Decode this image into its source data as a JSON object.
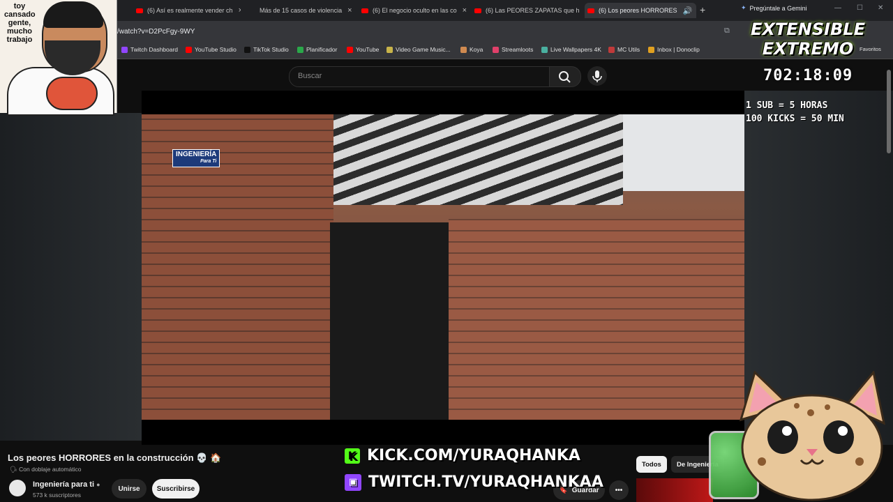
{
  "browser": {
    "tabs": [
      {
        "label": "(6) Así es realmente vender ch"
      },
      {
        "label": "Más de 15 casos de violencia"
      },
      {
        "label": "(6) El negocio oculto en las co"
      },
      {
        "label": "(6) Las PEORES ZAPATAS que h"
      },
      {
        "label": "(6) Los peores HORRORES"
      }
    ],
    "gemini": "Pregúntale a Gemini",
    "url": "/watch?v=D2PcFgy-9WY",
    "bookmarks": [
      {
        "label": "Twitch Dashboard",
        "color": "#9146ff"
      },
      {
        "label": "YouTube Studio",
        "color": "#ff0000"
      },
      {
        "label": "TikTok Studio",
        "color": "#111111"
      },
      {
        "label": "Planificador",
        "color": "#2aa84a"
      },
      {
        "label": "YouTube",
        "color": "#ff0000"
      },
      {
        "label": "Video Game Music...",
        "color": "#c8b44a"
      },
      {
        "label": "Koya",
        "color": "#d08a50"
      },
      {
        "label": "Streamloots",
        "color": "#e0406a"
      },
      {
        "label": "Live Wallpapers 4K",
        "color": "#4ab0a0"
      },
      {
        "label": "MC Utils",
        "color": "#c03a3a"
      },
      {
        "label": "Inbox | Donoclip",
        "color": "#e0a020"
      },
      {
        "label": "Favoritos",
        "color": "#888888"
      }
    ]
  },
  "youtube": {
    "search_placeholder": "Buscar",
    "video_logo": {
      "line1": "INGENIERÍA",
      "line2": "Para Ti"
    },
    "title": "Los peores HORRORES en la construcción 💀 🏠",
    "dub": "Con doblaje automático",
    "channel": "Ingeniería para ti",
    "subscribers": "573 k suscriptores",
    "join_label": "Unirse",
    "subscribe_label": "Suscribirse",
    "save_label": "Guardar",
    "more_label": "•••",
    "chips": [
      "Todos",
      "De Ingeniería"
    ]
  },
  "overlay": {
    "webcam_caption": "toy cansado gente, mucho trabajo",
    "event_logo": {
      "line1": "EXTENSIBLE",
      "line2": "EXTREMO"
    },
    "timer": "702:18:09",
    "rules": [
      "1 SUB = 5 HORAS",
      "100 KICKS = 50 MIN"
    ],
    "kick_url": "KICK.COM/YURAQHANKA",
    "twitch_url": "TWITCH.TV/YURAQHANKAA"
  }
}
